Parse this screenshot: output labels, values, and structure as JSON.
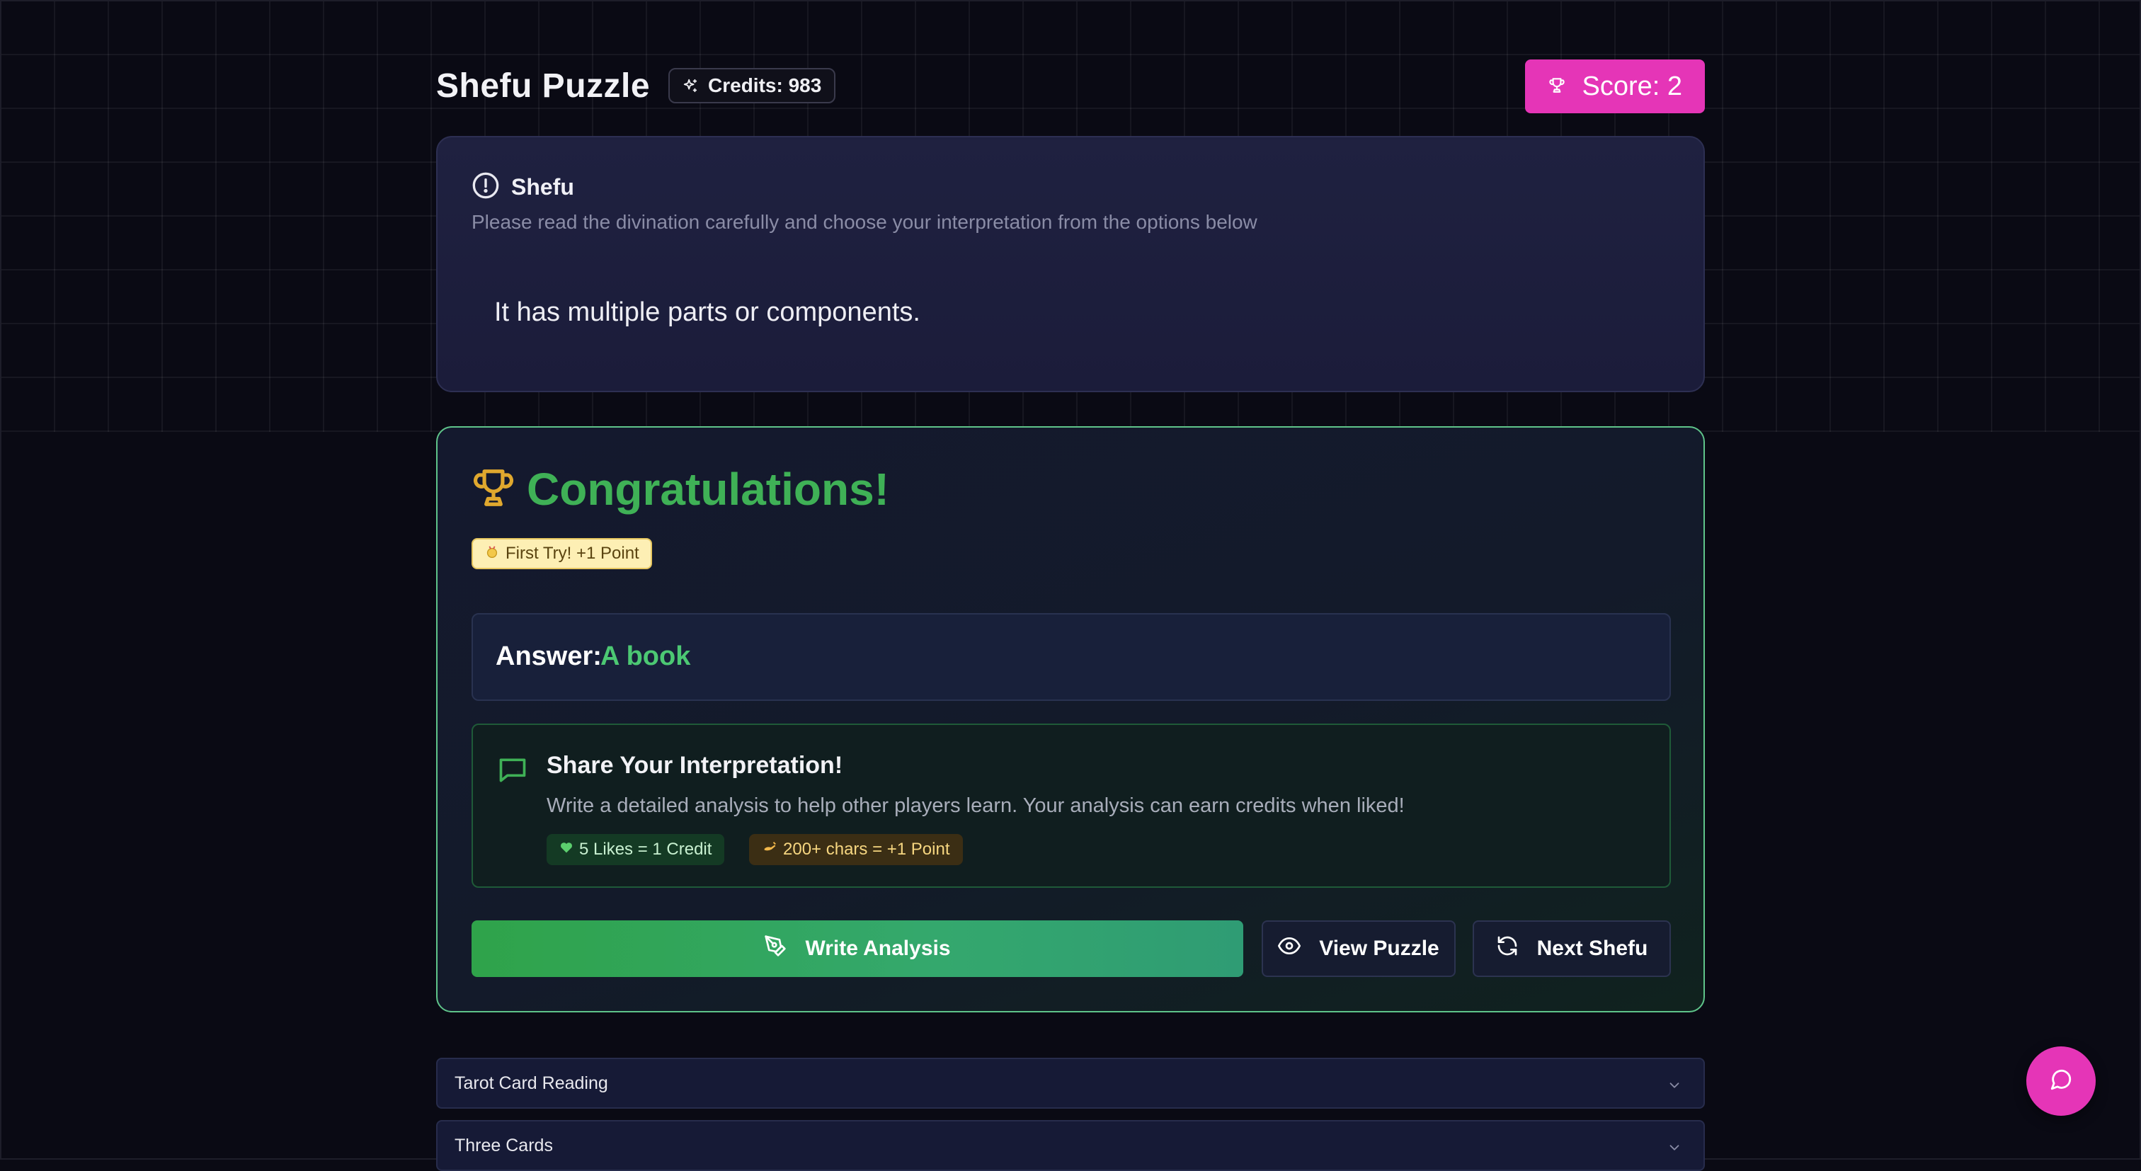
{
  "header": {
    "title": "Shefu Puzzle",
    "credits_label": "Credits: 983",
    "score_label": "Score: 2"
  },
  "shefu": {
    "title": "Shefu",
    "description": "Please read the divination carefully and choose your interpretation from the options below",
    "clue": "It has multiple parts or components."
  },
  "result": {
    "title": "Congratulations!",
    "first_try_badge": "First Try! +1 Point",
    "answer_label": "Answer:",
    "answer_value": "A book"
  },
  "share": {
    "title": "Share Your Interpretation!",
    "description": "Write a detailed analysis to help other players learn. Your analysis can earn credits when liked!",
    "likes_tag": "5 Likes = 1 Credit",
    "chars_tag": "200+ chars = +1 Point"
  },
  "actions": {
    "write_label": "Write Analysis",
    "view_label": "View Puzzle",
    "next_label": "Next Shefu"
  },
  "accordions": [
    {
      "label": "Tarot Card Reading"
    },
    {
      "label": "Three Cards"
    }
  ],
  "icons": {
    "credits": "sparkles-icon",
    "score": "trophy-icon",
    "info": "alert-circle-icon",
    "congrats": "trophy-icon",
    "first_try": "medal-icon",
    "share": "message-square-icon",
    "likes": "green-heart-icon",
    "chars": "writing-hand-icon",
    "write": "pen-tool-icon",
    "view": "eye-icon",
    "next": "refresh-icon",
    "accordion": "chevron-down-icon",
    "chat": "message-circle-icon"
  },
  "colors": {
    "background": "#0a0a14",
    "accent_pink": "#e535b7",
    "success_green": "#3fb156",
    "answer_green": "#4cc873",
    "trophy_gold": "#e0a82e",
    "card_border_green": "#5fc48a"
  }
}
